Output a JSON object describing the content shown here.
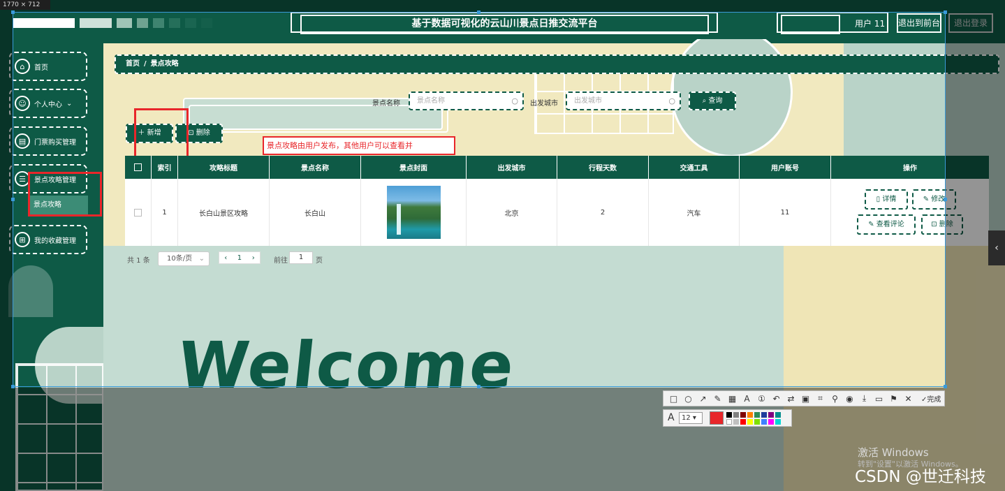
{
  "header": {
    "site_title": "基于数据可视化的云山川景点日推交流平台",
    "user_label": "用户 11",
    "front_button": "退出到前台",
    "logout_button": "退出登录"
  },
  "sidebar": {
    "items": [
      {
        "label": "首页",
        "icon": "home-icon"
      },
      {
        "label": "个人中心",
        "icon": "user-icon"
      },
      {
        "label": "门票购买管理",
        "icon": "ticket-icon"
      },
      {
        "label": "景点攻略管理",
        "icon": "guide-icon"
      },
      {
        "label": "我的收藏管理",
        "icon": "grid-icon"
      }
    ],
    "sub_item": "景点攻略"
  },
  "breadcrumb": {
    "home": "首页",
    "separator": "/",
    "current": "景点攻略"
  },
  "search": {
    "name_label": "景点名称",
    "name_placeholder": "景点名称",
    "city_label": "出发城市",
    "city_placeholder": "出发城市",
    "button": "查询"
  },
  "toolbar": {
    "add": "新增",
    "delete": "删除"
  },
  "annotation_note": "景点攻略由用户发布，其他用户可以查看并",
  "table": {
    "headers": [
      "索引",
      "攻略标题",
      "景点名称",
      "景点封面",
      "出发城市",
      "行程天数",
      "交通工具",
      "用户账号",
      "操作"
    ],
    "rows": [
      {
        "index": "1",
        "title": "长白山景区攻略",
        "spot": "长白山",
        "city": "北京",
        "days": "2",
        "transport": "汽车",
        "account": "11"
      }
    ],
    "actions": {
      "detail": "详情",
      "edit": "修改",
      "comments": "查看评论",
      "delete": "删除"
    }
  },
  "pagination": {
    "total": "共 1 条",
    "page_size": "10条/页",
    "current_page": "1",
    "goto_label": "前往",
    "goto_value": "1",
    "page_suffix": "页"
  },
  "welcome_text": "Welcome",
  "capture_tool": {
    "size_label": "1770 × 712",
    "font_size": "12",
    "done_label": "完成"
  },
  "watermarks": {
    "windows_activate": "激活 Windows",
    "windows_activate_sub": "转到\"设置\"以激活 Windows。",
    "csdn": "CSDN @世迁科技"
  },
  "colors": {
    "primary": "#0e5a46",
    "cream": "#f1e9bf",
    "mint": "#b9d3c8",
    "annotation_red": "#e8262a"
  }
}
